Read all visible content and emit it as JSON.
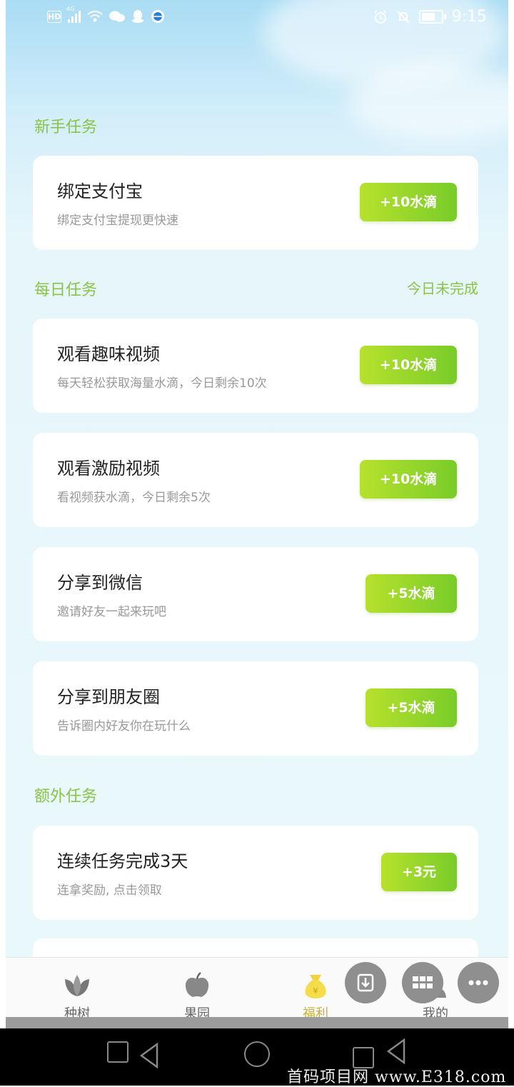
{
  "status_bar": {
    "network": "4G",
    "hd_badge": "HD",
    "time": "9:15"
  },
  "sections": {
    "newbie": {
      "title": "新手任务"
    },
    "daily": {
      "title": "每日任务",
      "status": "今日未完成"
    },
    "extra": {
      "title": "额外任务"
    }
  },
  "tasks": [
    {
      "title": "绑定支付宝",
      "desc": "绑定支付宝提现更快速",
      "reward": "+10水滴"
    },
    {
      "title": "观看趣味视频",
      "desc": "每天轻松获取海量水滴，今日剩余10次",
      "reward": "+10水滴"
    },
    {
      "title": "观看激励视频",
      "desc": "看视频获水滴，今日剩余5次",
      "reward": "+10水滴"
    },
    {
      "title": "分享到微信",
      "desc": "邀请好友一起来玩吧",
      "reward": "+5水滴"
    },
    {
      "title": "分享到朋友圈",
      "desc": "告诉圈内好友你在玩什么",
      "reward": "+5水滴"
    },
    {
      "title": "连续任务完成3天",
      "desc": "连拿奖励, 点击领取",
      "reward": "+3元"
    }
  ],
  "tabs": [
    {
      "label": "种树",
      "icon": "leaf-icon"
    },
    {
      "label": "果园",
      "icon": "apple-icon"
    },
    {
      "label": "福利",
      "icon": "money-bag-icon",
      "active": true
    },
    {
      "label": "我的",
      "icon": "person-icon"
    }
  ],
  "floating_buttons": [
    "download-icon",
    "grid-icon",
    "more-icon"
  ],
  "watermark": "首码项目网 www.E318.com",
  "colors": {
    "accent_green": "#8bc34a",
    "button_gradient_start": "#b7e12d",
    "button_gradient_end": "#79cc2a",
    "active_tab": "#c9b32a"
  }
}
